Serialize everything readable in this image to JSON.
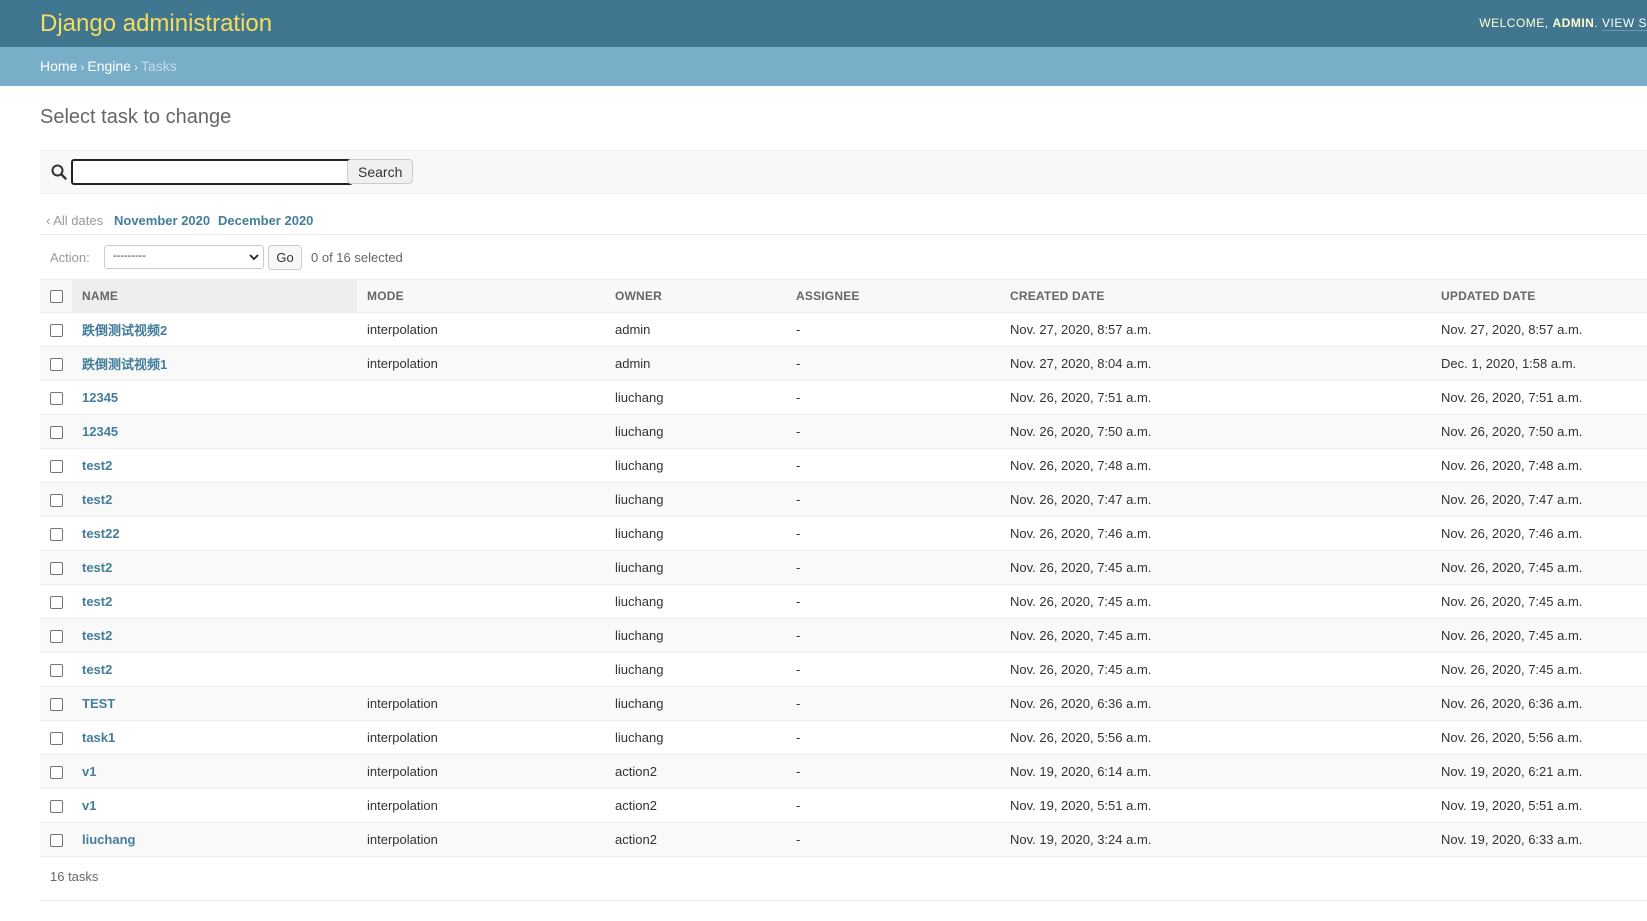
{
  "header": {
    "site_name": "Django administration",
    "welcome": "Welcome,",
    "username": "admin",
    "view_site": "View s"
  },
  "breadcrumbs": {
    "home": "Home",
    "app": "Engine",
    "current": "Tasks",
    "separator": "›"
  },
  "page_title": "Select task to change",
  "search": {
    "value": "",
    "placeholder": "",
    "button_label": "Search"
  },
  "date_hierarchy": {
    "all_dates": "‹ All dates",
    "items": [
      "November 2020",
      "December 2020"
    ]
  },
  "actions": {
    "label": "Action:",
    "selected_option": "---------",
    "go_label": "Go",
    "counter": "0 of 16 selected"
  },
  "table": {
    "columns": [
      "Name",
      "Mode",
      "Owner",
      "Assignee",
      "Created date",
      "Updated date"
    ],
    "rows": [
      [
        "跌倒测试视频2",
        "interpolation",
        "admin",
        "-",
        "Nov. 27, 2020, 8:57 a.m.",
        "Nov. 27, 2020, 8:57 a.m."
      ],
      [
        "跌倒测试视频1",
        "interpolation",
        "admin",
        "-",
        "Nov. 27, 2020, 8:04 a.m.",
        "Dec. 1, 2020, 1:58 a.m."
      ],
      [
        "12345",
        "",
        "liuchang",
        "-",
        "Nov. 26, 2020, 7:51 a.m.",
        "Nov. 26, 2020, 7:51 a.m."
      ],
      [
        "12345",
        "",
        "liuchang",
        "-",
        "Nov. 26, 2020, 7:50 a.m.",
        "Nov. 26, 2020, 7:50 a.m."
      ],
      [
        "test2",
        "",
        "liuchang",
        "-",
        "Nov. 26, 2020, 7:48 a.m.",
        "Nov. 26, 2020, 7:48 a.m."
      ],
      [
        "test2",
        "",
        "liuchang",
        "-",
        "Nov. 26, 2020, 7:47 a.m.",
        "Nov. 26, 2020, 7:47 a.m."
      ],
      [
        "test22",
        "",
        "liuchang",
        "-",
        "Nov. 26, 2020, 7:46 a.m.",
        "Nov. 26, 2020, 7:46 a.m."
      ],
      [
        "test2",
        "",
        "liuchang",
        "-",
        "Nov. 26, 2020, 7:45 a.m.",
        "Nov. 26, 2020, 7:45 a.m."
      ],
      [
        "test2",
        "",
        "liuchang",
        "-",
        "Nov. 26, 2020, 7:45 a.m.",
        "Nov. 26, 2020, 7:45 a.m."
      ],
      [
        "test2",
        "",
        "liuchang",
        "-",
        "Nov. 26, 2020, 7:45 a.m.",
        "Nov. 26, 2020, 7:45 a.m."
      ],
      [
        "test2",
        "",
        "liuchang",
        "-",
        "Nov. 26, 2020, 7:45 a.m.",
        "Nov. 26, 2020, 7:45 a.m."
      ],
      [
        "TEST",
        "interpolation",
        "liuchang",
        "-",
        "Nov. 26, 2020, 6:36 a.m.",
        "Nov. 26, 2020, 6:36 a.m."
      ],
      [
        "task1",
        "interpolation",
        "liuchang",
        "-",
        "Nov. 26, 2020, 5:56 a.m.",
        "Nov. 26, 2020, 5:56 a.m."
      ],
      [
        "v1",
        "interpolation",
        "action2",
        "-",
        "Nov. 19, 2020, 6:14 a.m.",
        "Nov. 19, 2020, 6:21 a.m."
      ],
      [
        "v1",
        "interpolation",
        "action2",
        "-",
        "Nov. 19, 2020, 5:51 a.m.",
        "Nov. 19, 2020, 5:51 a.m."
      ],
      [
        "liuchang",
        "interpolation",
        "action2",
        "-",
        "Nov. 19, 2020, 3:24 a.m.",
        "Nov. 19, 2020, 6:33 a.m."
      ]
    ]
  },
  "paginator": "16 tasks",
  "colors": {
    "header_bg": "#417690",
    "breadcrumb_bg": "#79aec8",
    "site_name": "#f5dd5d",
    "link": "#447e9b"
  },
  "icons": {
    "search": "search-icon",
    "select_arrow": "chevron-down-icon"
  }
}
